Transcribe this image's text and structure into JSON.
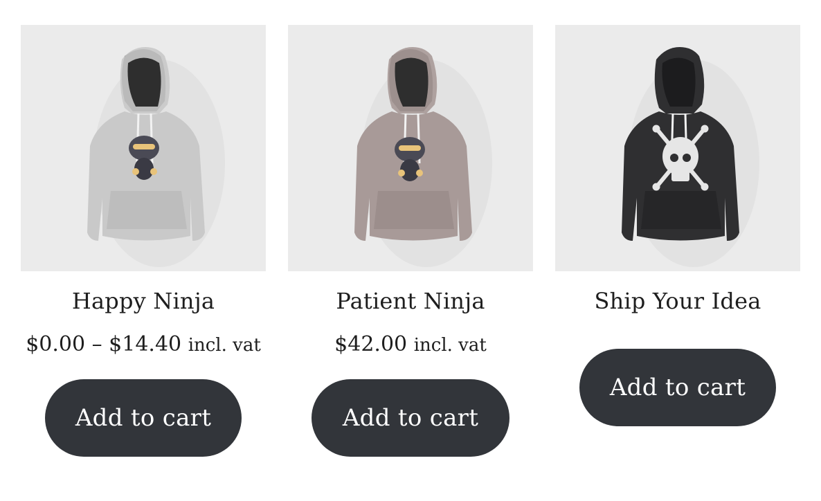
{
  "products": [
    {
      "title": "Happy Ninja",
      "price": "$0.00 – $14.40",
      "vat": "incl. vat",
      "button": "Add to cart",
      "hoodie_color": "#c9c9c9",
      "graphic": "ninja-graphic"
    },
    {
      "title": "Patient Ninja",
      "price": "$42.00",
      "vat": "incl. vat",
      "button": "Add to cart",
      "hoodie_color": "#a89a98",
      "graphic": "ninja-graphic"
    },
    {
      "title": "Ship Your Idea",
      "button": "Add to cart",
      "hoodie_color": "#2f2f31",
      "graphic": "skull-graphic"
    }
  ],
  "colors": {
    "button_bg": "#32353a",
    "image_bg": "#ebebeb"
  }
}
